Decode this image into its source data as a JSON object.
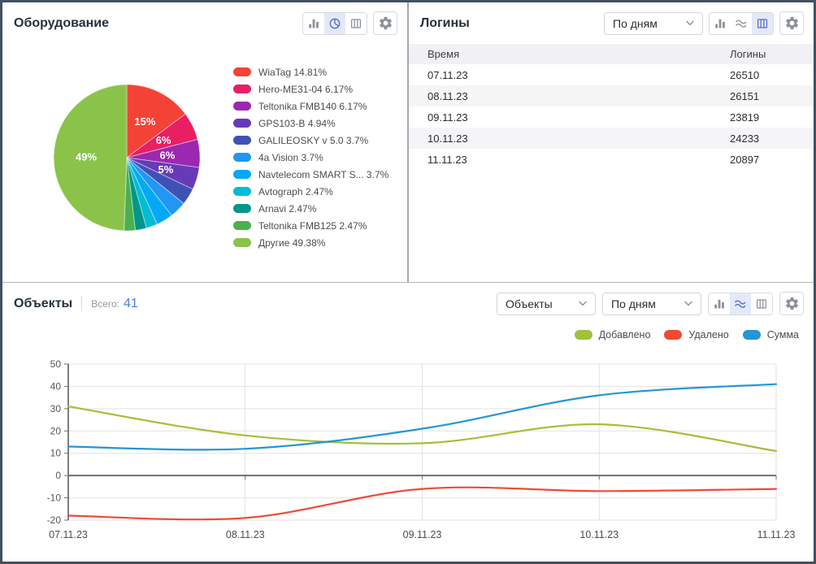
{
  "equipment": {
    "title": "Оборудование",
    "toolbar": {
      "views": [
        "bar-chart",
        "pie-chart",
        "table"
      ],
      "selected_view": "pie-chart"
    }
  },
  "logins": {
    "title": "Логины",
    "period_select": {
      "value": "По дням"
    },
    "table": {
      "columns": [
        "Время",
        "Логины"
      ],
      "rows": [
        {
          "time": "07.11.23",
          "logins": "26510"
        },
        {
          "time": "08.11.23",
          "logins": "26151"
        },
        {
          "time": "09.11.23",
          "logins": "23819"
        },
        {
          "time": "10.11.23",
          "logins": "24233"
        },
        {
          "time": "11.11.23",
          "logins": "20897"
        }
      ]
    },
    "toolbar": {
      "views": [
        "bar-chart",
        "line-chart",
        "table"
      ],
      "selected_view": "table"
    }
  },
  "objects": {
    "title": "Объекты",
    "total_label": "Всего:",
    "total_value": "41",
    "type_select": {
      "value": "Объекты"
    },
    "period_select": {
      "value": "По дням"
    },
    "toolbar": {
      "views": [
        "bar-chart",
        "line-chart",
        "table"
      ],
      "selected_view": "line-chart"
    }
  },
  "colors": {
    "selected_icon_blue": "#5a6fd1",
    "selected_icon_bg": "#e4e9f8",
    "icon_gray": "#8e949c",
    "total_count_blue": "#4a7fd8",
    "window_border": "#3f5063"
  },
  "chart_data": [
    {
      "type": "pie",
      "title": "Оборудование",
      "labels": [
        "WiaTag",
        "Hero-ME31-04",
        "Teltonika FMB140",
        "GPS103-B",
        "GALILEOSKY v 5.0",
        "4a Vision",
        "Navtelecom SMART S...",
        "Avtograph",
        "Arnavi",
        "Teltonika FMB125",
        "Другие"
      ],
      "values": [
        14.81,
        6.17,
        6.17,
        4.94,
        3.7,
        3.7,
        3.7,
        2.47,
        2.47,
        2.47,
        49.38
      ],
      "colors": [
        "#f44336",
        "#e91e63",
        "#9c27b0",
        "#673ab7",
        "#3f51b5",
        "#2196f3",
        "#03a9f4",
        "#00bcd4",
        "#009688",
        "#4caf50",
        "#8bc34a"
      ],
      "slice_labels": [
        "15%",
        "6%",
        "6%",
        "5%",
        "",
        "",
        "",
        "",
        "",
        "",
        "49%"
      ],
      "legend": [
        "WiaTag 14.81%",
        "Hero-ME31-04 6.17%",
        "Teltonika FMB140 6.17%",
        "GPS103-B 4.94%",
        "GALILEOSKY v 5.0 3.7%",
        "4a Vision 3.7%",
        "Navtelecom SMART S... 3.7%",
        "Avtograph 2.47%",
        "Arnavi 2.47%",
        "Teltonika FMB125 2.47%",
        "Другие  49.38%"
      ],
      "legend_position": "right"
    },
    {
      "type": "line",
      "title": "Объекты",
      "x": [
        "07.11.23",
        "08.11.23",
        "09.11.23",
        "10.11.23",
        "11.11.23"
      ],
      "series": [
        {
          "name": "Добавлено",
          "color": "#a1c13a",
          "values": [
            31,
            18,
            14.5,
            23,
            11
          ]
        },
        {
          "name": "Удалено",
          "color": "#ef4a36",
          "values": [
            -18,
            -19,
            -6,
            -7,
            -6
          ]
        },
        {
          "name": "Сумма",
          "color": "#2595d5",
          "values": [
            13,
            12,
            21,
            36,
            41
          ]
        }
      ],
      "ylim": [
        -20,
        50
      ],
      "yticks": [
        50,
        40,
        30,
        20,
        10,
        0,
        -10,
        -20
      ],
      "grid": true,
      "legend_position": "top-right"
    }
  ]
}
